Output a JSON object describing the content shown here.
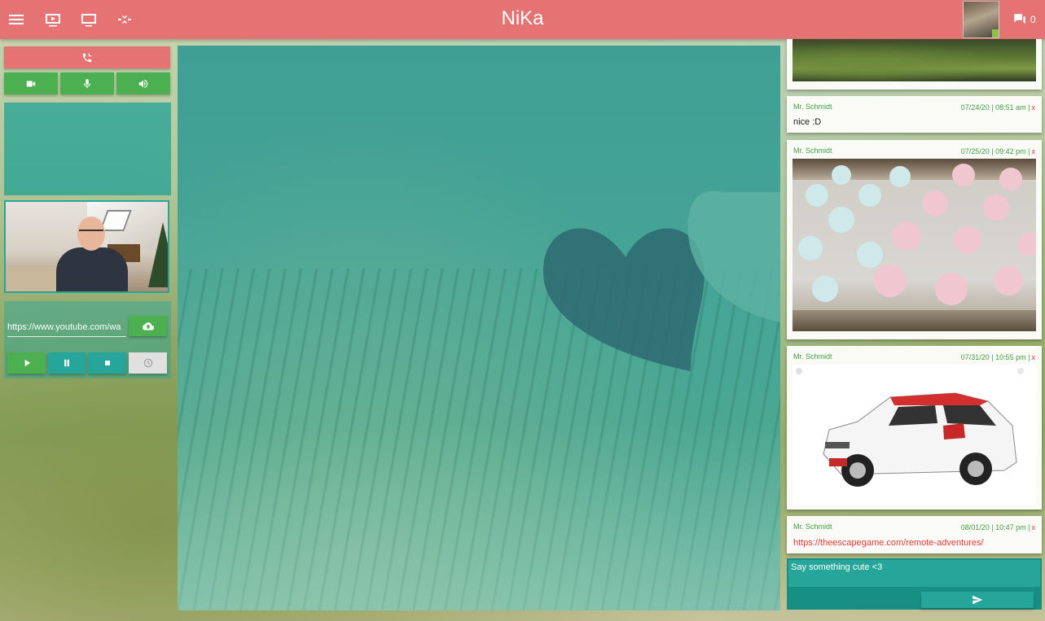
{
  "app": {
    "title": "NiKa"
  },
  "topbar": {
    "icons": [
      "menu-icon",
      "media-player-icon",
      "screen-share-icon",
      "compress-icon"
    ],
    "chat_count": "0"
  },
  "left": {
    "call_button": {
      "icon": "phone-icon",
      "color": "#e57373"
    },
    "media_toggles": [
      "video-camera-icon",
      "microphone-icon",
      "speaker-icon"
    ],
    "url": {
      "value": "https://www.youtube.com/wa"
    },
    "load_button": {
      "icon": "cloud-upload-icon"
    },
    "playback": [
      "play-icon",
      "pause-icon",
      "stop-icon",
      "clock-icon"
    ]
  },
  "chat": {
    "messages": [
      {
        "type": "image",
        "image": "landscape"
      },
      {
        "author": "Mr. Schmidt",
        "time": "07/24/20 | 08:51 am |",
        "delete": "x",
        "text": "nice :D"
      },
      {
        "author": "Mr. Schmidt",
        "time": "07/25/20 | 09:42 pm |",
        "delete": "x",
        "image": "meringues"
      },
      {
        "author": "Mr. Schmidt",
        "time": "07/31/20 | 10:55 pm |",
        "delete": "x",
        "image": "car"
      },
      {
        "author": "Mr. Schmidt",
        "time": "08/01/20 | 10:47 pm |",
        "delete": "x",
        "link": "https://theescapegame.com/remote-adventures/"
      }
    ],
    "input": {
      "placeholder": "Say something cute <3"
    },
    "send_icon": "send-icon"
  },
  "colors": {
    "topbar": "#e57373",
    "green": "#4caf50",
    "teal": "#26a69a",
    "author": "#43a047",
    "delete": "#e53935"
  }
}
